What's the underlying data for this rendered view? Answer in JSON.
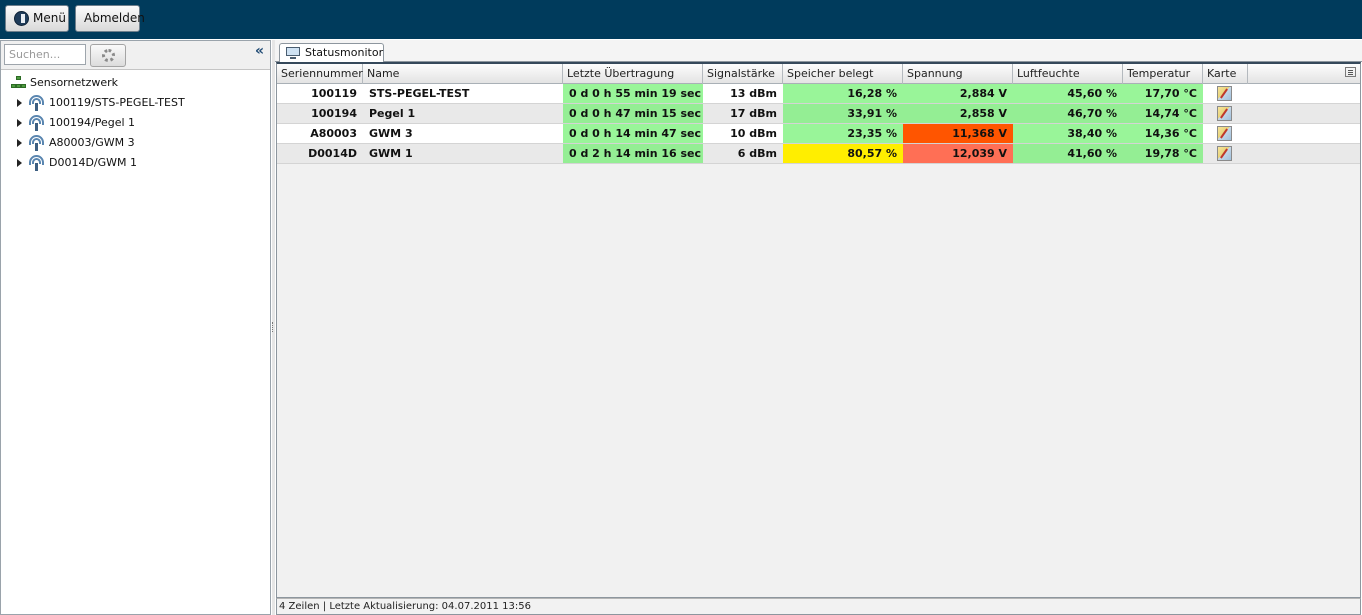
{
  "topbar": {
    "menu_label": "Menü",
    "logout_label": "Abmelden"
  },
  "sidebar": {
    "search_placeholder": "Suchen...",
    "collapse_glyph": "«",
    "root_label": "Sensornetzwerk",
    "items": [
      {
        "label": "100119/STS-PEGEL-TEST"
      },
      {
        "label": "100194/Pegel 1"
      },
      {
        "label": "A80003/GWM 3"
      },
      {
        "label": "D0014D/GWM 1"
      }
    ]
  },
  "tab": {
    "label": "Statusmonitor"
  },
  "table": {
    "columns": [
      "Seriennummer",
      "Name",
      "Letzte Übertragung",
      "Signalstärke",
      "Speicher belegt",
      "Spannung",
      "Luftfeuchte",
      "Temperatur",
      "Karte"
    ],
    "rows": [
      {
        "serial": "100119",
        "name": "STS-PEGEL-TEST",
        "last_tx": "0 d 0 h 55 min 19 sec",
        "signal": "13 dBm",
        "memory": "16,28 %",
        "voltage": "2,884 V",
        "humidity": "45,60 %",
        "temperature": "17,70 °C"
      },
      {
        "serial": "100194",
        "name": "Pegel 1",
        "last_tx": "0 d 0 h 47 min 15 sec",
        "signal": "17 dBm",
        "memory": "33,91 %",
        "voltage": "2,858 V",
        "humidity": "46,70 %",
        "temperature": "14,74 °C"
      },
      {
        "serial": "A80003",
        "name": "GWM 3",
        "last_tx": "0 d 0 h 14 min 47 sec",
        "signal": "10 dBm",
        "memory": "23,35 %",
        "voltage": "11,368 V",
        "humidity": "38,40 %",
        "temperature": "14,36 °C"
      },
      {
        "serial": "D0014D",
        "name": "GWM 1",
        "last_tx": "0 d 2 h 14 min 16 sec",
        "signal": "6 dBm",
        "memory": "80,57 %",
        "voltage": "12,039 V",
        "humidity": "41,60 %",
        "temperature": "19,78 °C"
      }
    ]
  },
  "status_colors": {
    "ok_green": "#99f599",
    "warn_yellow": "#ffee00",
    "alert_red": "#ff5500",
    "alert_light_red": "#ff6f55"
  },
  "statusbar": {
    "text": "4 Zeilen | Letzte Aktualisierung: 04.07.2011 13:56"
  }
}
